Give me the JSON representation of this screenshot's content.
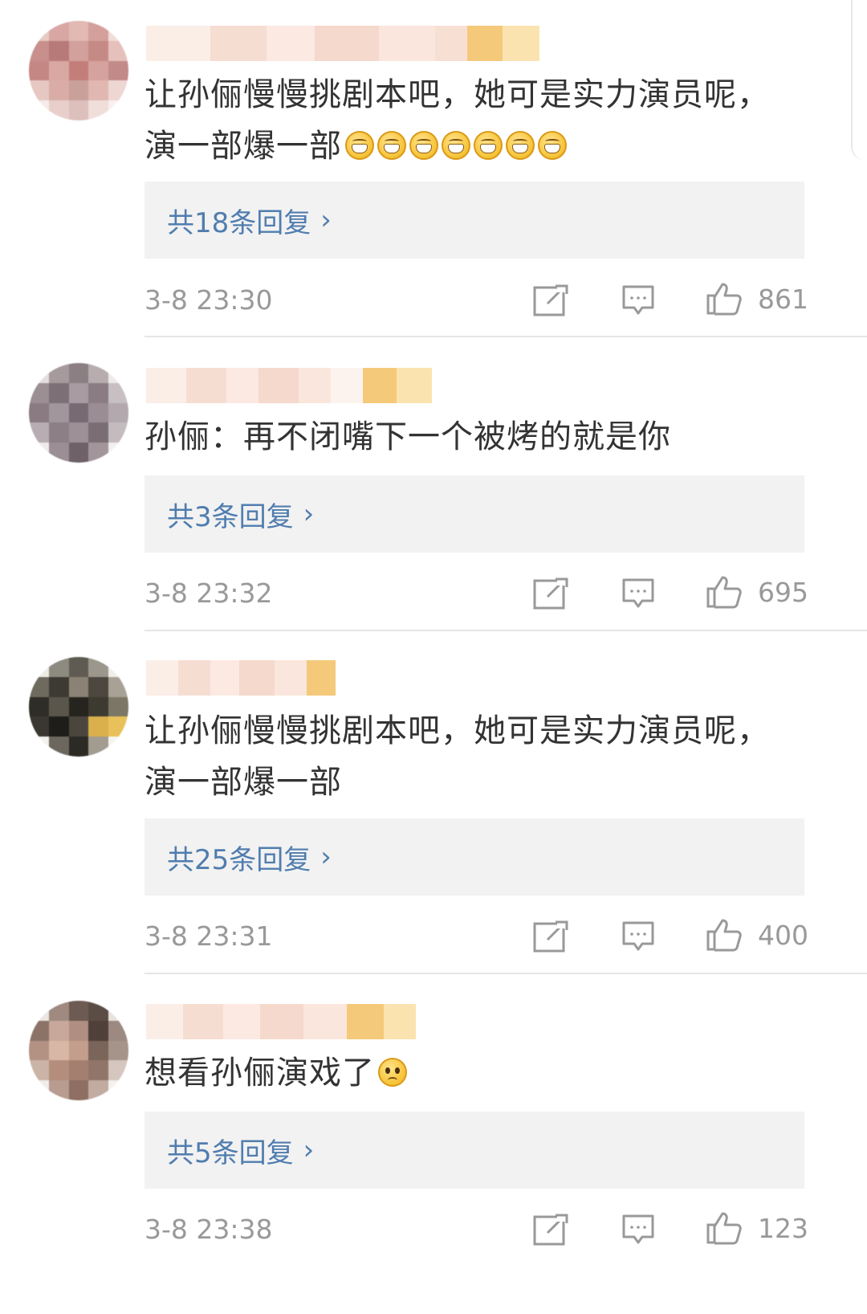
{
  "colors": {
    "link": "#507daf",
    "meta": "#999999",
    "text": "#333333",
    "reply_box_bg": "#f2f2f2",
    "divider": "#e6e6e6"
  },
  "icons": {
    "repost": "repost-icon",
    "comment": "comment-icon",
    "like": "thumbs-up-icon",
    "reply_chevron": "chevron-right-icon"
  },
  "comments": [
    {
      "text_lines": [
        "让孙俪慢慢挑剧本吧，她可是实力演员呢，",
        "演一部爆一部"
      ],
      "emojis": [
        "grin",
        "grin",
        "grin",
        "grin",
        "grin",
        "grin",
        "grin"
      ],
      "replies_label": "共18条回复",
      "time": "3-8 23:30",
      "likes": "861"
    },
    {
      "text_lines": [
        "孙俪：再不闭嘴下一个被烤的就是你"
      ],
      "emojis": [],
      "replies_label": "共3条回复",
      "time": "3-8 23:32",
      "likes": "695"
    },
    {
      "text_lines": [
        "让孙俪慢慢挑剧本吧，她可是实力演员呢，",
        "演一部爆一部"
      ],
      "emojis": [],
      "replies_label": "共25条回复",
      "time": "3-8 23:31",
      "likes": "400"
    },
    {
      "text_lines": [
        "想看孙俪演戏了"
      ],
      "emojis": [
        "sad"
      ],
      "replies_label": "共5条回复",
      "time": "3-8 23:38",
      "likes": "123"
    }
  ],
  "chevron": "›"
}
